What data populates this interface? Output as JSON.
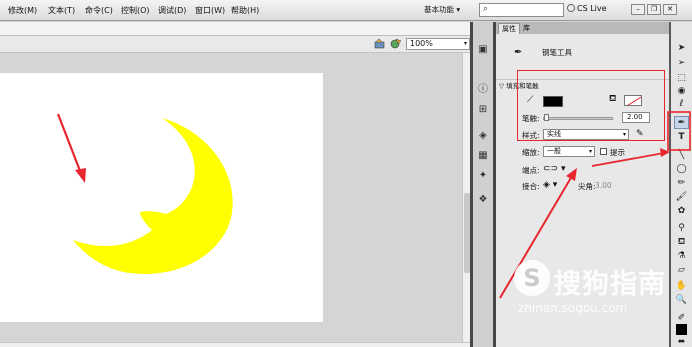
{
  "menu": {
    "items": [
      "修改(M)",
      "文本(T)",
      "命令(C)",
      "控制(O)",
      "调试(D)",
      "窗口(W)",
      "帮助(H)"
    ],
    "workspace": "基本功能",
    "workspace_arrow": "▾",
    "search_icon": "⌕",
    "cs_live": "CS Live",
    "win_min": "–",
    "win_restore": "❐",
    "win_close": "✕"
  },
  "stage": {
    "zoom": "100%",
    "zoom_arrow": "▾",
    "moon_color": "#ffff00",
    "arrow_color": "#e8262e"
  },
  "panel": {
    "tabs": [
      "属性",
      "库"
    ],
    "tool_name": "钢笔工具",
    "tool_icon": "pen-icon",
    "section": "▽ 填充和笔触",
    "stroke_label": "笔触:",
    "stroke_value": "2.00",
    "style_label": "样式:",
    "style_value": "实线",
    "scale_label": "缩放:",
    "scale_value": "一般",
    "hint_label": "提示",
    "cap_label": "端点:",
    "join_label": "接合:",
    "miter_label": "尖角:",
    "miter_value": "3.00",
    "highlight_color": "#e8262e"
  },
  "watermark": {
    "logo": "S",
    "name": "搜狗指南",
    "url": "zhinan.sogou.com"
  }
}
